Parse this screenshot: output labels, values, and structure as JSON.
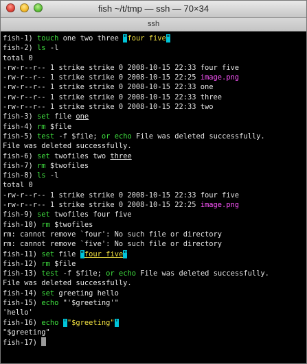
{
  "window": {
    "title": "fish  ~/t/tmp — ssh — 70×34",
    "tab_label": "ssh"
  },
  "colors": {
    "command": "#3fe03f",
    "string": "#f0e040",
    "executable_file": "#ff55ff",
    "match_highlight": "#00c4d8"
  },
  "terminal": {
    "lines": [
      [
        {
          "t": "fish-1) "
        },
        {
          "t": "touch",
          "c": "g"
        },
        {
          "t": " one two three "
        },
        {
          "t": "\"",
          "c": "hl"
        },
        {
          "t": "four five",
          "c": "y"
        },
        {
          "t": "\"",
          "c": "hl"
        }
      ],
      [
        {
          "t": "fish-2) "
        },
        {
          "t": "ls",
          "c": "g"
        },
        {
          "t": " -l"
        }
      ],
      [
        {
          "t": "total 0"
        }
      ],
      [
        {
          "t": "-rw-r--r-- 1 strike strike 0 2008-10-15 22:33 four five"
        }
      ],
      [
        {
          "t": "-rw-r--r-- 1 strike strike 0 2008-10-15 22:25 "
        },
        {
          "t": "image.png",
          "c": "m"
        }
      ],
      [
        {
          "t": "-rw-r--r-- 1 strike strike 0 2008-10-15 22:33 one"
        }
      ],
      [
        {
          "t": "-rw-r--r-- 1 strike strike 0 2008-10-15 22:33 three"
        }
      ],
      [
        {
          "t": "-rw-r--r-- 1 strike strike 0 2008-10-15 22:33 two"
        }
      ],
      [
        {
          "t": "fish-3) "
        },
        {
          "t": "set",
          "c": "g"
        },
        {
          "t": " file "
        },
        {
          "t": "one",
          "c": "u"
        }
      ],
      [
        {
          "t": "fish-4) "
        },
        {
          "t": "rm",
          "c": "g"
        },
        {
          "t": " $file"
        }
      ],
      [
        {
          "t": "fish-5) "
        },
        {
          "t": "test",
          "c": "g"
        },
        {
          "t": " -f $file; "
        },
        {
          "t": "or",
          "c": "g"
        },
        {
          "t": " "
        },
        {
          "t": "echo",
          "c": "g"
        },
        {
          "t": " File was deleted successfully."
        }
      ],
      [
        {
          "t": "File was deleted successfully."
        }
      ],
      [
        {
          "t": "fish-6) "
        },
        {
          "t": "set",
          "c": "g"
        },
        {
          "t": " twofiles two "
        },
        {
          "t": "three",
          "c": "u"
        }
      ],
      [
        {
          "t": "fish-7) "
        },
        {
          "t": "rm",
          "c": "g"
        },
        {
          "t": " $twofiles"
        }
      ],
      [
        {
          "t": "fish-8) "
        },
        {
          "t": "ls",
          "c": "g"
        },
        {
          "t": " -l"
        }
      ],
      [
        {
          "t": "total 0"
        }
      ],
      [
        {
          "t": "-rw-r--r-- 1 strike strike 0 2008-10-15 22:33 four five"
        }
      ],
      [
        {
          "t": "-rw-r--r-- 1 strike strike 0 2008-10-15 22:25 "
        },
        {
          "t": "image.png",
          "c": "m"
        }
      ],
      [
        {
          "t": "fish-9) "
        },
        {
          "t": "set",
          "c": "g"
        },
        {
          "t": " twofiles four five"
        }
      ],
      [
        {
          "t": "fish-10) "
        },
        {
          "t": "rm",
          "c": "g"
        },
        {
          "t": " $twofiles"
        }
      ],
      [
        {
          "t": "rm: cannot remove `four': No such file or directory"
        }
      ],
      [
        {
          "t": "rm: cannot remove `five': No such file or directory"
        }
      ],
      [
        {
          "t": "fish-11) "
        },
        {
          "t": "set",
          "c": "g"
        },
        {
          "t": " file "
        },
        {
          "t": "\"",
          "c": "hl"
        },
        {
          "t": "four five",
          "c": "y u"
        },
        {
          "t": "\"",
          "c": "hl"
        }
      ],
      [
        {
          "t": "fish-12) "
        },
        {
          "t": "rm",
          "c": "g"
        },
        {
          "t": " $file"
        }
      ],
      [
        {
          "t": "fish-13) "
        },
        {
          "t": "test",
          "c": "g"
        },
        {
          "t": " -f $file; "
        },
        {
          "t": "or",
          "c": "g"
        },
        {
          "t": " "
        },
        {
          "t": "echo",
          "c": "g"
        },
        {
          "t": " File was deleted successfully."
        }
      ],
      [
        {
          "t": "File was deleted successfully."
        }
      ],
      [
        {
          "t": "fish-14) "
        },
        {
          "t": "set",
          "c": "g"
        },
        {
          "t": " greeting hello"
        }
      ],
      [
        {
          "t": "fish-15) "
        },
        {
          "t": "echo",
          "c": "g"
        },
        {
          "t": " \"'$greeting'\""
        }
      ],
      [
        {
          "t": "'hello'"
        }
      ],
      [
        {
          "t": "fish-16) "
        },
        {
          "t": "echo",
          "c": "g"
        },
        {
          "t": " "
        },
        {
          "t": "'",
          "c": "hl"
        },
        {
          "t": "\"$greeting\"",
          "c": "y"
        },
        {
          "t": "'",
          "c": "hl"
        }
      ],
      [
        {
          "t": "\"$greeting\""
        }
      ],
      [
        {
          "t": "fish-17) "
        },
        {
          "cursor": true
        }
      ]
    ]
  }
}
